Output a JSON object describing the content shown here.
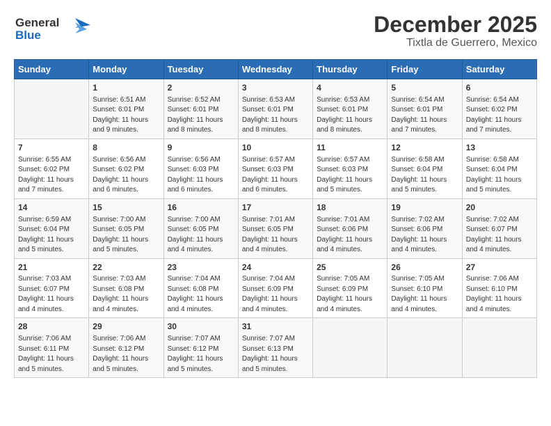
{
  "header": {
    "logo_line1": "General",
    "logo_line2": "Blue",
    "month": "December 2025",
    "location": "Tixtla de Guerrero, Mexico"
  },
  "weekdays": [
    "Sunday",
    "Monday",
    "Tuesday",
    "Wednesday",
    "Thursday",
    "Friday",
    "Saturday"
  ],
  "weeks": [
    [
      {
        "day": "",
        "sunrise": "",
        "sunset": "",
        "daylight": ""
      },
      {
        "day": "1",
        "sunrise": "Sunrise: 6:51 AM",
        "sunset": "Sunset: 6:01 PM",
        "daylight": "Daylight: 11 hours and 9 minutes."
      },
      {
        "day": "2",
        "sunrise": "Sunrise: 6:52 AM",
        "sunset": "Sunset: 6:01 PM",
        "daylight": "Daylight: 11 hours and 8 minutes."
      },
      {
        "day": "3",
        "sunrise": "Sunrise: 6:53 AM",
        "sunset": "Sunset: 6:01 PM",
        "daylight": "Daylight: 11 hours and 8 minutes."
      },
      {
        "day": "4",
        "sunrise": "Sunrise: 6:53 AM",
        "sunset": "Sunset: 6:01 PM",
        "daylight": "Daylight: 11 hours and 8 minutes."
      },
      {
        "day": "5",
        "sunrise": "Sunrise: 6:54 AM",
        "sunset": "Sunset: 6:01 PM",
        "daylight": "Daylight: 11 hours and 7 minutes."
      },
      {
        "day": "6",
        "sunrise": "Sunrise: 6:54 AM",
        "sunset": "Sunset: 6:02 PM",
        "daylight": "Daylight: 11 hours and 7 minutes."
      }
    ],
    [
      {
        "day": "7",
        "sunrise": "Sunrise: 6:55 AM",
        "sunset": "Sunset: 6:02 PM",
        "daylight": "Daylight: 11 hours and 7 minutes."
      },
      {
        "day": "8",
        "sunrise": "Sunrise: 6:56 AM",
        "sunset": "Sunset: 6:02 PM",
        "daylight": "Daylight: 11 hours and 6 minutes."
      },
      {
        "day": "9",
        "sunrise": "Sunrise: 6:56 AM",
        "sunset": "Sunset: 6:03 PM",
        "daylight": "Daylight: 11 hours and 6 minutes."
      },
      {
        "day": "10",
        "sunrise": "Sunrise: 6:57 AM",
        "sunset": "Sunset: 6:03 PM",
        "daylight": "Daylight: 11 hours and 6 minutes."
      },
      {
        "day": "11",
        "sunrise": "Sunrise: 6:57 AM",
        "sunset": "Sunset: 6:03 PM",
        "daylight": "Daylight: 11 hours and 5 minutes."
      },
      {
        "day": "12",
        "sunrise": "Sunrise: 6:58 AM",
        "sunset": "Sunset: 6:04 PM",
        "daylight": "Daylight: 11 hours and 5 minutes."
      },
      {
        "day": "13",
        "sunrise": "Sunrise: 6:58 AM",
        "sunset": "Sunset: 6:04 PM",
        "daylight": "Daylight: 11 hours and 5 minutes."
      }
    ],
    [
      {
        "day": "14",
        "sunrise": "Sunrise: 6:59 AM",
        "sunset": "Sunset: 6:04 PM",
        "daylight": "Daylight: 11 hours and 5 minutes."
      },
      {
        "day": "15",
        "sunrise": "Sunrise: 7:00 AM",
        "sunset": "Sunset: 6:05 PM",
        "daylight": "Daylight: 11 hours and 5 minutes."
      },
      {
        "day": "16",
        "sunrise": "Sunrise: 7:00 AM",
        "sunset": "Sunset: 6:05 PM",
        "daylight": "Daylight: 11 hours and 4 minutes."
      },
      {
        "day": "17",
        "sunrise": "Sunrise: 7:01 AM",
        "sunset": "Sunset: 6:05 PM",
        "daylight": "Daylight: 11 hours and 4 minutes."
      },
      {
        "day": "18",
        "sunrise": "Sunrise: 7:01 AM",
        "sunset": "Sunset: 6:06 PM",
        "daylight": "Daylight: 11 hours and 4 minutes."
      },
      {
        "day": "19",
        "sunrise": "Sunrise: 7:02 AM",
        "sunset": "Sunset: 6:06 PM",
        "daylight": "Daylight: 11 hours and 4 minutes."
      },
      {
        "day": "20",
        "sunrise": "Sunrise: 7:02 AM",
        "sunset": "Sunset: 6:07 PM",
        "daylight": "Daylight: 11 hours and 4 minutes."
      }
    ],
    [
      {
        "day": "21",
        "sunrise": "Sunrise: 7:03 AM",
        "sunset": "Sunset: 6:07 PM",
        "daylight": "Daylight: 11 hours and 4 minutes."
      },
      {
        "day": "22",
        "sunrise": "Sunrise: 7:03 AM",
        "sunset": "Sunset: 6:08 PM",
        "daylight": "Daylight: 11 hours and 4 minutes."
      },
      {
        "day": "23",
        "sunrise": "Sunrise: 7:04 AM",
        "sunset": "Sunset: 6:08 PM",
        "daylight": "Daylight: 11 hours and 4 minutes."
      },
      {
        "day": "24",
        "sunrise": "Sunrise: 7:04 AM",
        "sunset": "Sunset: 6:09 PM",
        "daylight": "Daylight: 11 hours and 4 minutes."
      },
      {
        "day": "25",
        "sunrise": "Sunrise: 7:05 AM",
        "sunset": "Sunset: 6:09 PM",
        "daylight": "Daylight: 11 hours and 4 minutes."
      },
      {
        "day": "26",
        "sunrise": "Sunrise: 7:05 AM",
        "sunset": "Sunset: 6:10 PM",
        "daylight": "Daylight: 11 hours and 4 minutes."
      },
      {
        "day": "27",
        "sunrise": "Sunrise: 7:06 AM",
        "sunset": "Sunset: 6:10 PM",
        "daylight": "Daylight: 11 hours and 4 minutes."
      }
    ],
    [
      {
        "day": "28",
        "sunrise": "Sunrise: 7:06 AM",
        "sunset": "Sunset: 6:11 PM",
        "daylight": "Daylight: 11 hours and 5 minutes."
      },
      {
        "day": "29",
        "sunrise": "Sunrise: 7:06 AM",
        "sunset": "Sunset: 6:12 PM",
        "daylight": "Daylight: 11 hours and 5 minutes."
      },
      {
        "day": "30",
        "sunrise": "Sunrise: 7:07 AM",
        "sunset": "Sunset: 6:12 PM",
        "daylight": "Daylight: 11 hours and 5 minutes."
      },
      {
        "day": "31",
        "sunrise": "Sunrise: 7:07 AM",
        "sunset": "Sunset: 6:13 PM",
        "daylight": "Daylight: 11 hours and 5 minutes."
      },
      {
        "day": "",
        "sunrise": "",
        "sunset": "",
        "daylight": ""
      },
      {
        "day": "",
        "sunrise": "",
        "sunset": "",
        "daylight": ""
      },
      {
        "day": "",
        "sunrise": "",
        "sunset": "",
        "daylight": ""
      }
    ]
  ]
}
